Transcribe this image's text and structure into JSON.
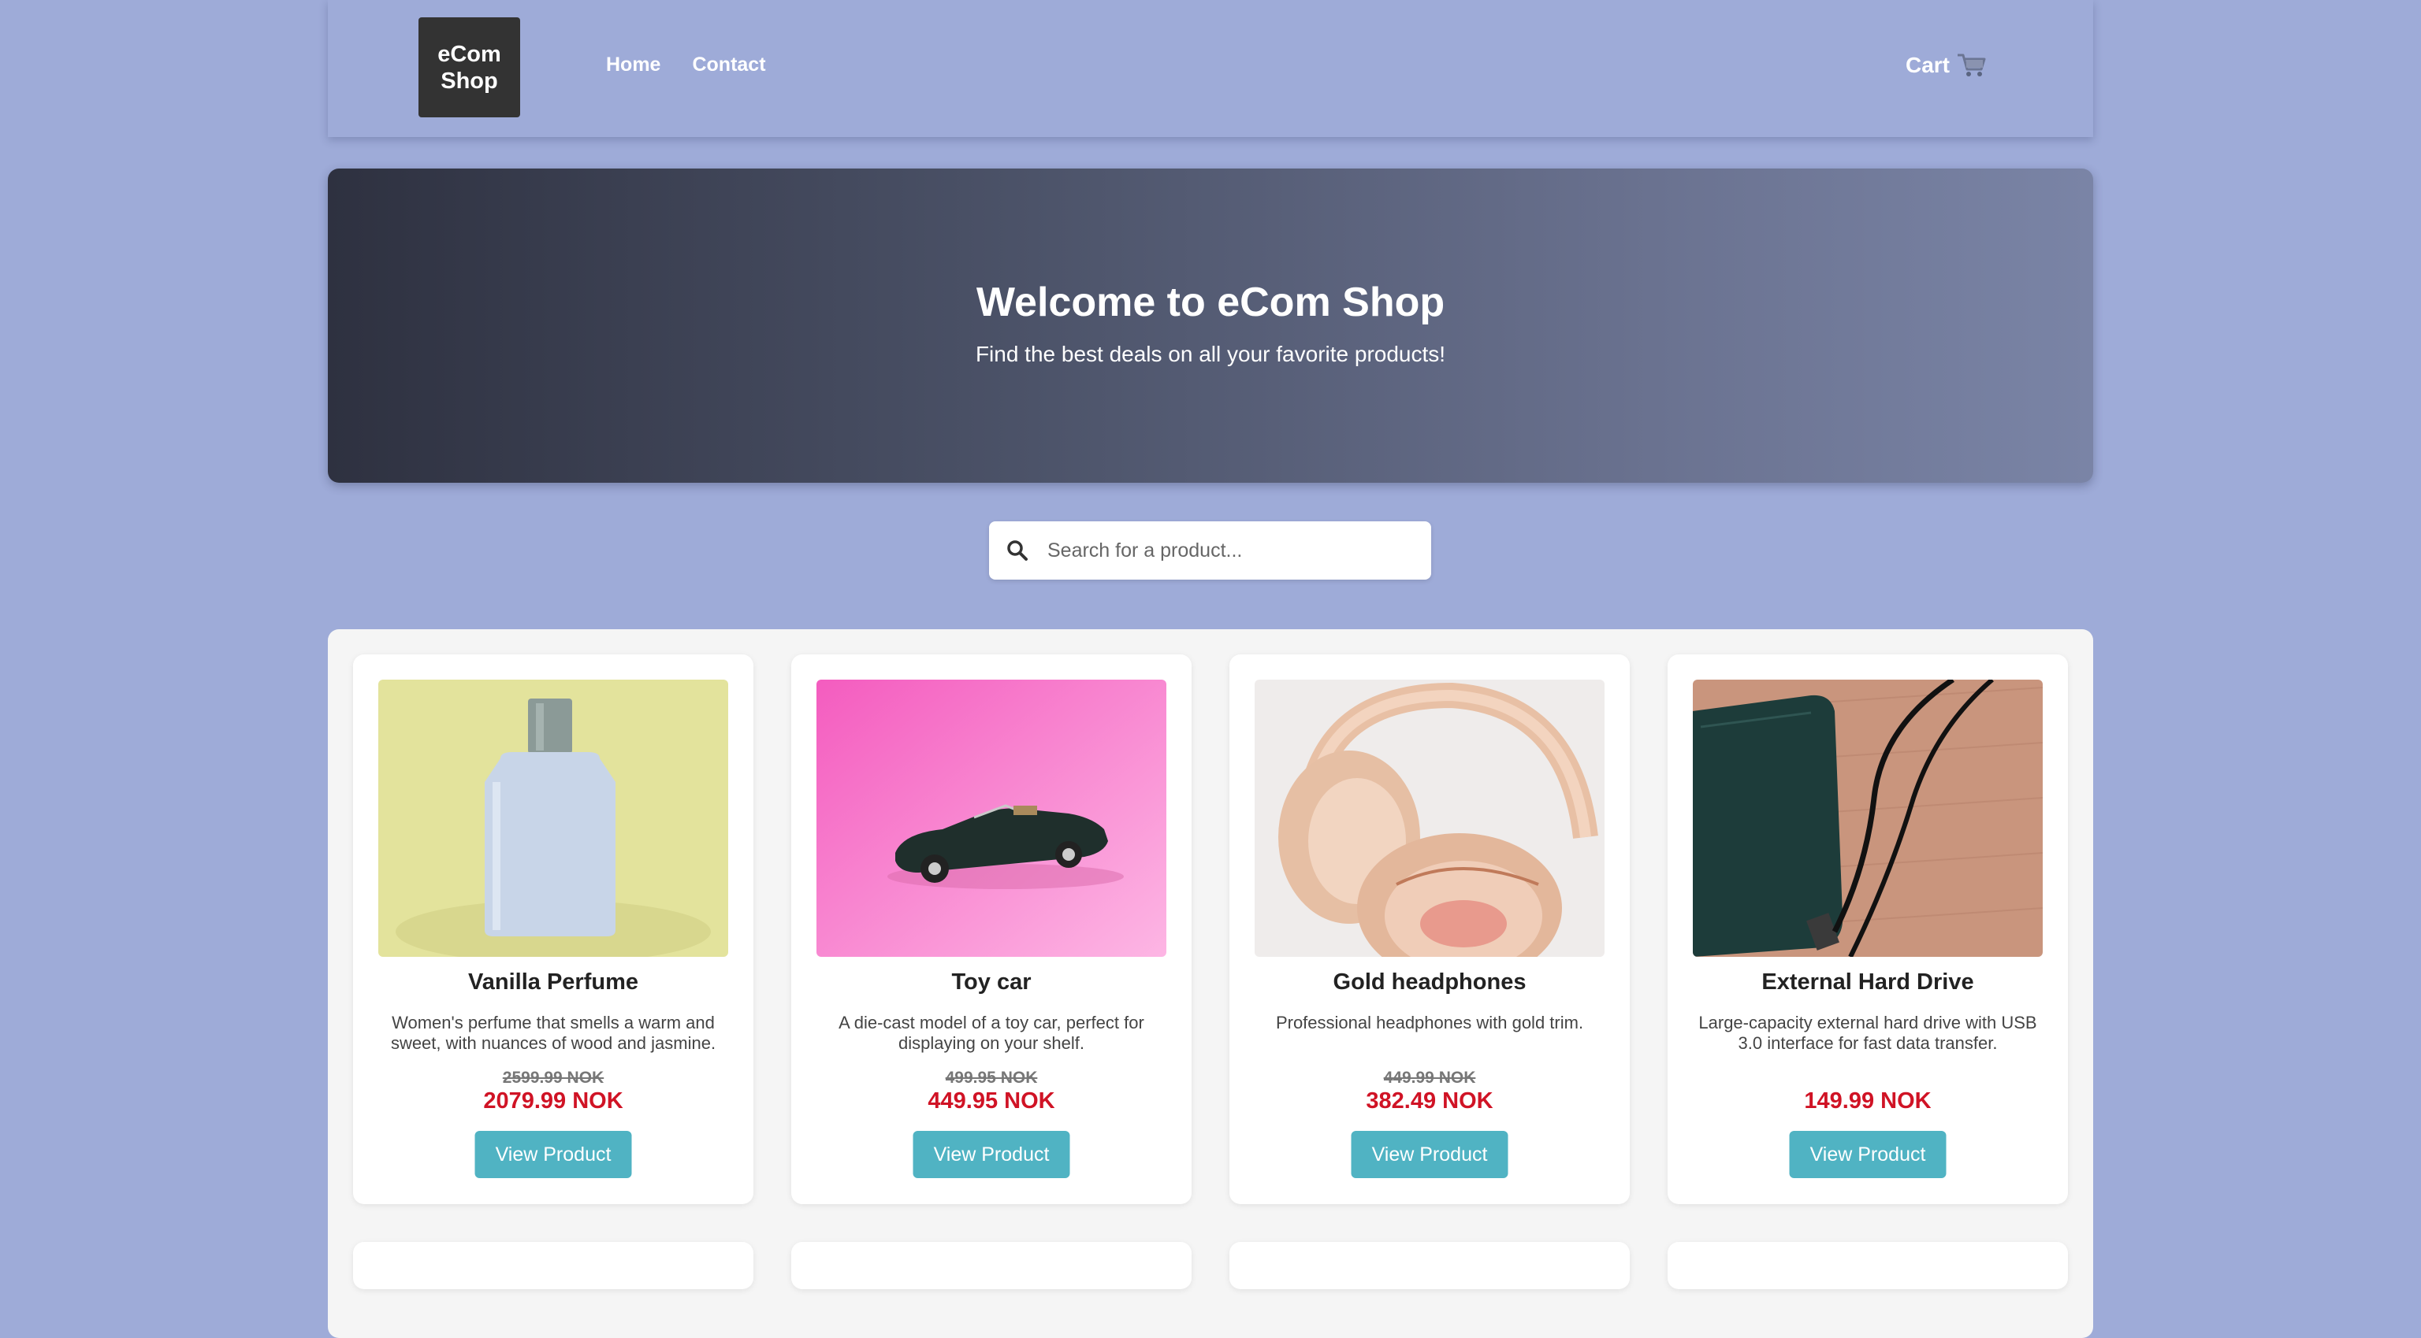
{
  "header": {
    "logo_line1": "eCom",
    "logo_line2": "Shop",
    "nav": [
      {
        "label": "Home"
      },
      {
        "label": "Contact"
      }
    ],
    "cart_label": "Cart",
    "cart_icon": "cart-icon"
  },
  "hero": {
    "title": "Welcome to eCom Shop",
    "subtitle": "Find the best deals on all your favorite products!"
  },
  "search": {
    "placeholder": "Search for a product...",
    "value": "",
    "icon": "search-icon"
  },
  "products": [
    {
      "title": "Vanilla Perfume",
      "description": "Women's perfume that smells a warm and sweet, with nuances of wood and jasmine.",
      "old_price": "2599.99 NOK",
      "price": "2079.99 NOK",
      "button": "View Product"
    },
    {
      "title": "Toy car",
      "description": "A die-cast model of a toy car, perfect for displaying on your shelf.",
      "old_price": "499.95 NOK",
      "price": "449.95 NOK",
      "button": "View Product"
    },
    {
      "title": "Gold headphones",
      "description": "Professional headphones with gold trim.",
      "old_price": "449.99 NOK",
      "price": "382.49 NOK",
      "button": "View Product"
    },
    {
      "title": "External Hard Drive",
      "description": "Large-capacity external hard drive with USB 3.0 interface for fast data transfer.",
      "old_price": "",
      "price": "149.99 NOK",
      "button": "View Product"
    }
  ],
  "colors": {
    "background": "#9eabd8",
    "accent_button": "#50b3c3",
    "price_red": "#d01325"
  }
}
